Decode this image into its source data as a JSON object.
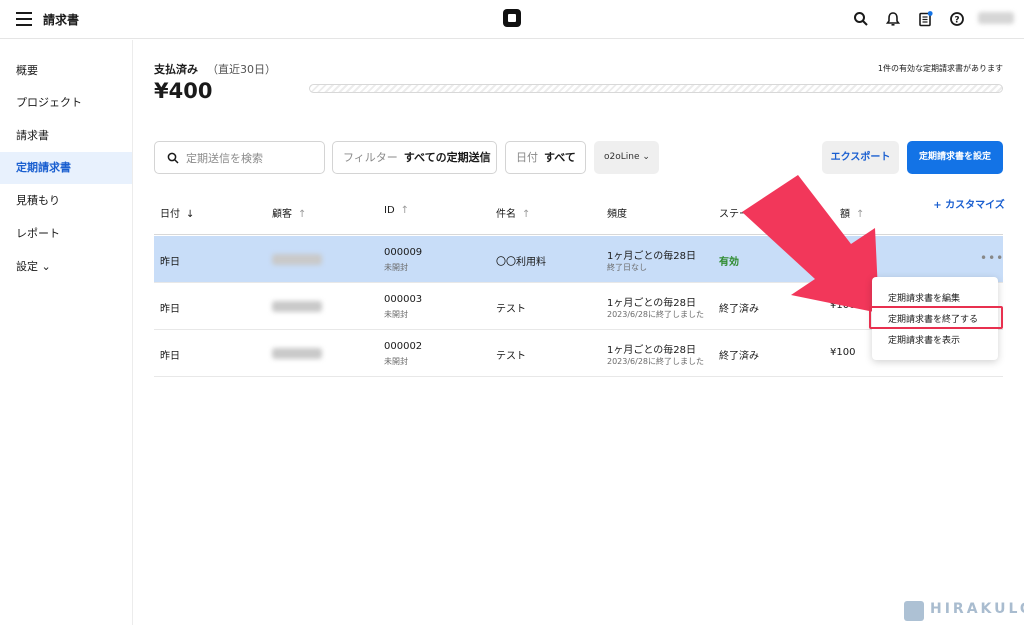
{
  "header": {
    "title": "請求書",
    "icons": [
      "menu-icon",
      "square-logo-icon",
      "search-icon",
      "bell-icon",
      "clipboard-icon",
      "help-icon"
    ],
    "notification_color": "#1373e6"
  },
  "sidebar": {
    "items": [
      {
        "label": "概要"
      },
      {
        "label": "プロジェクト"
      },
      {
        "label": "請求書"
      },
      {
        "label": "定期請求書",
        "active": true
      },
      {
        "label": "見積もり"
      },
      {
        "label": "レポート"
      },
      {
        "label": "設定 ⌄"
      }
    ],
    "active_color": "#1a5fd0"
  },
  "summary": {
    "paid_label": "支払済み",
    "period_label": "（直近30日）",
    "amount": "¥400",
    "active_note": "1件の有効な定期請求書があります"
  },
  "controls": {
    "search_placeholder": "定期送信を検索",
    "filter_key": "フィルター",
    "filter_value": "すべての定期送信",
    "date_key": "日付",
    "date_value": "すべて",
    "location": "o2oLine",
    "export_label": "エクスポート",
    "setup_label": "定期請求書を設定",
    "accent_color": "#1373e6"
  },
  "table": {
    "columns": [
      "日付",
      "顧客",
      "ID",
      "件名",
      "頻度",
      "ステータス",
      "額"
    ],
    "customize_label": "+ カスタマイズ",
    "rows": [
      {
        "date": "昨日",
        "id": "000009",
        "id_sub": "未開封",
        "subject": "〇〇利用料",
        "frequency": "1ヶ月ごとの毎28日",
        "frequency_sub": "終了日なし",
        "status": "有効",
        "amount": ""
      },
      {
        "date": "昨日",
        "id": "000003",
        "id_sub": "未開封",
        "subject": "テスト",
        "frequency": "1ヶ月ごとの毎28日",
        "frequency_sub": "2023/6/28に終了しました",
        "status": "終了済み",
        "amount": "¥100"
      },
      {
        "date": "昨日",
        "id": "000002",
        "id_sub": "未開封",
        "subject": "テスト",
        "frequency": "1ヶ月ごとの毎28日",
        "frequency_sub": "2023/6/28に終了しました",
        "status": "終了済み",
        "amount": "¥100"
      }
    ],
    "more_label": "•••"
  },
  "context_menu": {
    "items": [
      "定期請求書を編集",
      "定期請求書を終了する",
      "定期請求書を表示"
    ],
    "highlight_color": "#e8304f"
  },
  "annotation": {
    "arrow_color": "#f2375a"
  },
  "watermark": {
    "text": "HIRAKULOG"
  }
}
